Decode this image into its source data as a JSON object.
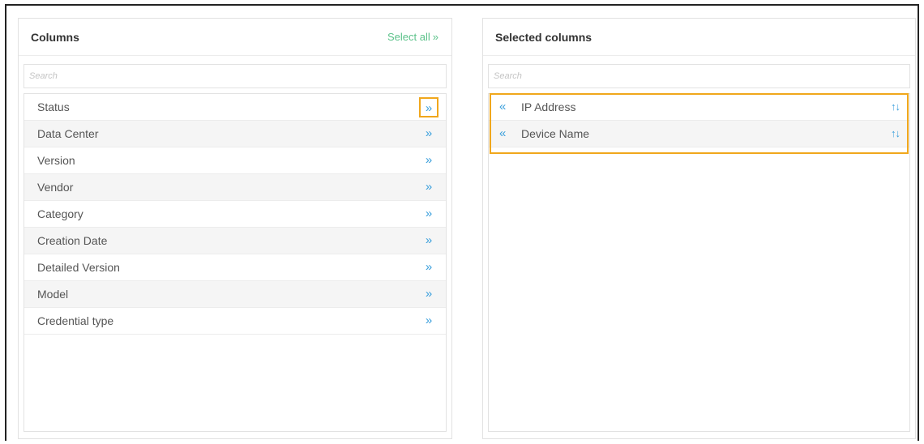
{
  "columns_panel": {
    "title": "Columns",
    "select_all_label": "Select all",
    "select_all_icon": "»",
    "search_placeholder": "Search",
    "add_icon": "»",
    "items": [
      {
        "label": "Status"
      },
      {
        "label": "Data Center"
      },
      {
        "label": "Version"
      },
      {
        "label": "Vendor"
      },
      {
        "label": "Category"
      },
      {
        "label": "Creation Date"
      },
      {
        "label": "Detailed Version"
      },
      {
        "label": "Model"
      },
      {
        "label": "Credential type"
      }
    ]
  },
  "selected_panel": {
    "title": "Selected columns",
    "search_placeholder": "Search",
    "remove_icon": "«",
    "sort_icon": "↑↓",
    "items": [
      {
        "label": "IP Address"
      },
      {
        "label": "Device Name"
      }
    ]
  },
  "colors": {
    "accent_green": "#5cc28a",
    "icon_blue": "#3a9fdc",
    "highlight_orange": "#f0a71c"
  }
}
